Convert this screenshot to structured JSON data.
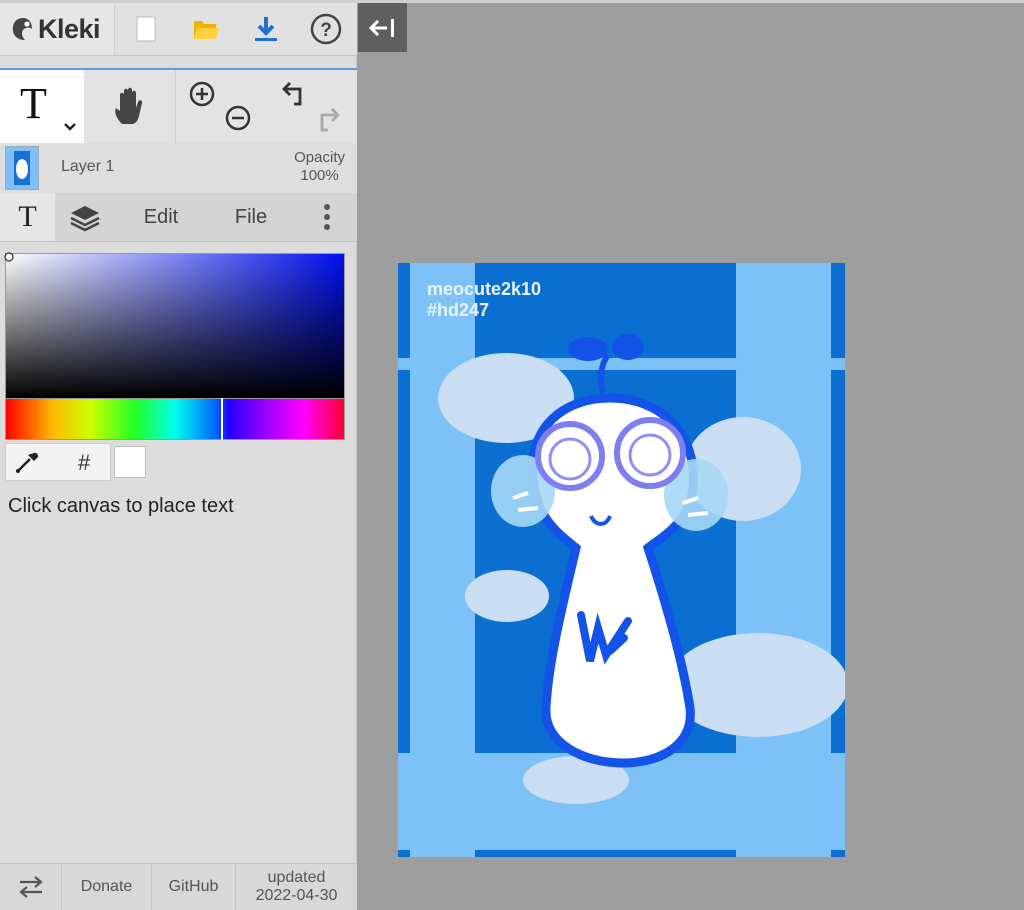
{
  "app": {
    "logo_text": "Kleki"
  },
  "toolbar": {
    "buttons": [
      "new-file",
      "open-file",
      "download",
      "help"
    ]
  },
  "tools": {
    "active_tool": "text",
    "active_tool_glyph": "T"
  },
  "layer": {
    "name": "Layer 1",
    "opacity_label": "Opacity",
    "opacity_value": "100%"
  },
  "tabs": {
    "edit": "Edit",
    "file": "File"
  },
  "color": {
    "hex_symbol": "#",
    "current": "#ffffff"
  },
  "hint": "Click canvas to place text",
  "footer": {
    "donate": "Donate",
    "github": "GitHub",
    "updated_label": "updated",
    "updated_date": "2022-04-30"
  },
  "canvas": {
    "signature_line1": "meocute2k10",
    "signature_line2": "#hd247"
  },
  "colors": {
    "accent": "#5a9ae0",
    "canvas_bg": "#9e9e9e",
    "panel_bg": "#dcdcdc"
  }
}
